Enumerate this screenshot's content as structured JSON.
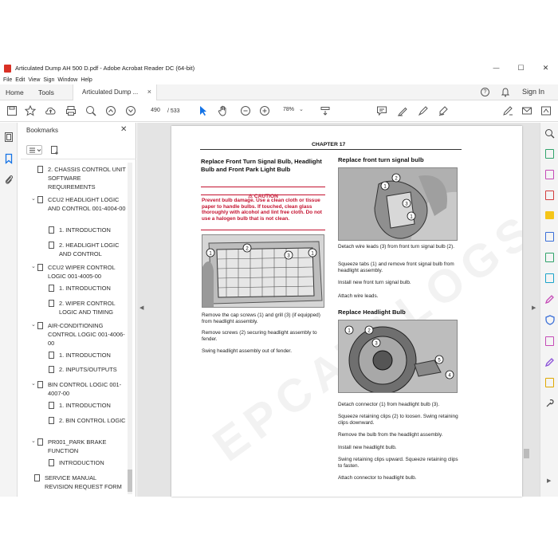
{
  "window": {
    "title": "Articulated Dump AH 500 D.pdf - Adobe Acrobat Reader DC (64-bit)",
    "minimize": "—",
    "maximize": "☐",
    "close": "✕"
  },
  "menu": [
    "File",
    "Edit",
    "View",
    "Sign",
    "Window",
    "Help"
  ],
  "tabs": {
    "home": "Home",
    "tools": "Tools",
    "doc": "Articulated Dump ...",
    "doc_close": "×",
    "sign_in": "Sign In"
  },
  "toolbar": {
    "page_current": "490",
    "page_total": "/  533",
    "zoom": "78%"
  },
  "bookmarks": {
    "title": "Bookmarks",
    "close": "✕",
    "items": [
      {
        "label": "2. CHASSIS CONTROL UNIT SOFTWARE REQUIREMENTS"
      },
      {
        "label": "CCU2 HEADLIGHT LOGIC AND CONTROL 001-4004-00"
      },
      {
        "label": "1. INTRODUCTION"
      },
      {
        "label": "2. HEADLIGHT LOGIC AND CONTROL"
      },
      {
        "label": "CCU2 WIPER CONTROL LOGIC 001-4005-00"
      },
      {
        "label": "1. INTRODUCTION"
      },
      {
        "label": "2. WIPER CONTROL LOGIC AND TIMING"
      },
      {
        "label": "AIR-CONDITIONING CONTROL LOGIC 001-4006-00"
      },
      {
        "label": "1. INTRODUCTION"
      },
      {
        "label": "2. INPUTS/OUTPUTS"
      },
      {
        "label": "BIN CONTROL LOGIC 001-4007-00"
      },
      {
        "label": "1. INTRODUCTION"
      },
      {
        "label": "2. BIN CONTROL LOGIC"
      },
      {
        "label": "PR001_PARK BRAKE FUNCTION"
      },
      {
        "label": "INTRODUCTION"
      },
      {
        "label": "SERVICE MANUAL REVISION REQUEST FORM"
      }
    ]
  },
  "page": {
    "chapter": "CHAPTER 17",
    "left_heading": "Replace Front Turn Signal Bulb, Headlight Bulb and Front Park Light Bulb",
    "caution_label": "⚠ CAUTION",
    "caution_text": "Prevent bulb damage. Use a clean cloth or tissue paper to handle bulbs. If touched, clean glass thoroughly with alcohol and lint free cloth. Do not use a halogen bulb that is not clean.",
    "left_steps": [
      "Remove the cap screws (1) and grill (3) (if equipped) from headlight assembly.",
      "Remove screws (2) securing headlight assembly to fender.",
      "Swing headlight assembly out of fender."
    ],
    "right_heading1": "Replace front turn signal bulb",
    "right_steps1": [
      "Detach wire leads (3) from front turn signal bulb (2).",
      "Squeeze tabs (1) and remove front signal bulb from headlight assembly.",
      "Install new front turn signal bulb.",
      "Attach wire leads."
    ],
    "right_heading2": "Replace Headlight Bulb",
    "right_steps2": [
      "Detach connector (1) from headlight bulb (3).",
      "Squeeze retaining clips (2) to loosen. Swing retaining clips downward.",
      "Remove the bulb from the headlight assembly.",
      "Install new headlight bulb.",
      "Swing retaining clips upward. Squeeze retaining clips to fasten.",
      "Attach connector to headlight bulb."
    ],
    "photo1_callouts": [
      "1",
      "2",
      "3",
      "1"
    ],
    "photo2_callouts": [
      "1",
      "2",
      "3",
      "1"
    ],
    "photo3_callouts": [
      "1",
      "2",
      "3",
      "5",
      "4"
    ],
    "watermark": "EPCATALOGS.COM"
  }
}
